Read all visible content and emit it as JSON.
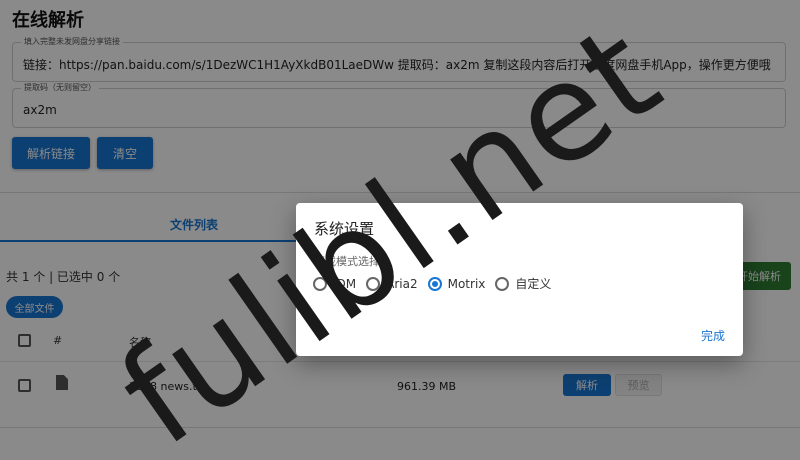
{
  "header": {
    "title": "在线解析"
  },
  "link_field": {
    "label": "填入完整未发网盘分享链接",
    "value": "链接：https://pan.baidu.com/s/1DezWC1H1AyXkdB01LaeDWw  提取码：ax2m  复制这段内容后打开百度网盘手机App，操作更方便哦"
  },
  "code_field": {
    "label": "提取码（无则留空）",
    "value": "ax2m"
  },
  "actions": {
    "parse_label": "解析链接",
    "clear_label": "清空"
  },
  "tabs": {
    "file_list": "文件列表"
  },
  "list_summary": {
    "text": "共 1 个 | 已选中 0 个",
    "start_label": "开始解析",
    "all_files_chip": "全部文件"
  },
  "table": {
    "headers": {
      "index": "#",
      "name": "名称"
    },
    "rows": [
      {
        "name": "3868 news.tar",
        "size": "961.39 MB",
        "parse_label": "解析",
        "preview_label": "预览"
      }
    ]
  },
  "dialog": {
    "title": "系统设置",
    "subtitle": "下载模式选择",
    "options": [
      "IDM",
      "Aria2",
      "Motrix",
      "自定义"
    ],
    "selected": "Motrix",
    "done_label": "完成"
  },
  "watermark": {
    "text": "fulibl.net"
  },
  "colors": {
    "primary": "#1976d2",
    "success": "#2e7d32",
    "overlay": "rgba(0,0,0,0.46)"
  }
}
